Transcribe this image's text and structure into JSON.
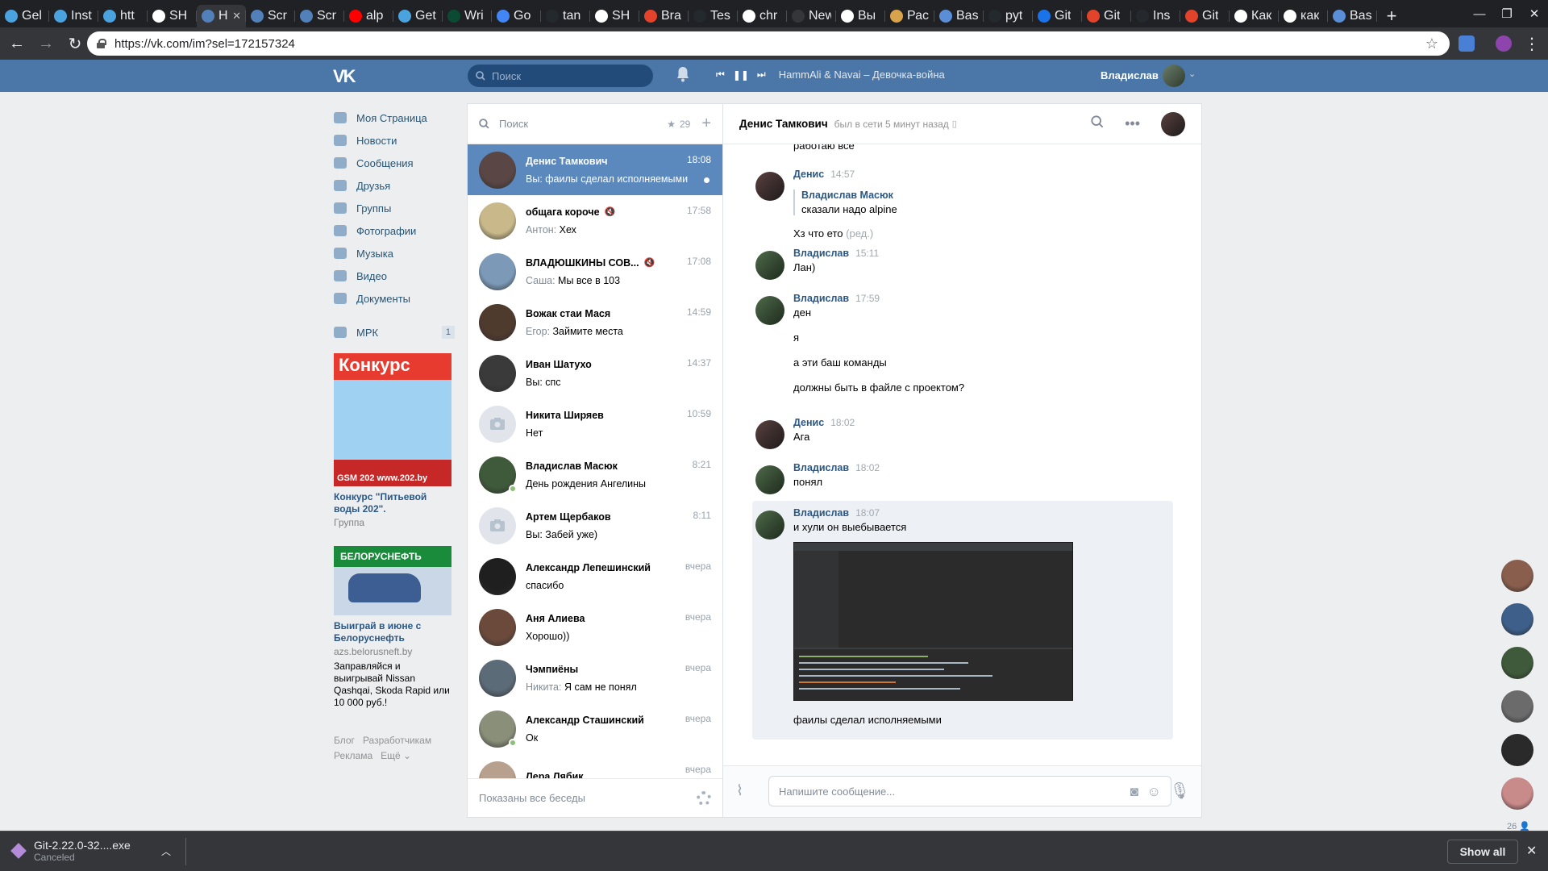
{
  "browser": {
    "tabs": [
      {
        "label": "Gel",
        "color": "#4aa3df"
      },
      {
        "label": "Inst",
        "color": "#4aa3df"
      },
      {
        "label": "htt",
        "color": "#4aa3df"
      },
      {
        "label": "SH",
        "color": "#ffffff"
      },
      {
        "label": "H",
        "color": "#5181b8",
        "active": true
      },
      {
        "label": "Scr",
        "color": "#5181b8"
      },
      {
        "label": "Scr",
        "color": "#5181b8"
      },
      {
        "label": "alp",
        "color": "#ff0000"
      },
      {
        "label": "Get",
        "color": "#4aa3df"
      },
      {
        "label": "Wri",
        "color": "#0c4b33"
      },
      {
        "label": "Go",
        "color": "#4285f4"
      },
      {
        "label": "tan",
        "color": "#24292e"
      },
      {
        "label": "SH",
        "color": "#ffffff"
      },
      {
        "label": "Bra",
        "color": "#e2432a"
      },
      {
        "label": "Tes",
        "color": "#24292e"
      },
      {
        "label": "chr",
        "color": "#ffffff"
      },
      {
        "label": "New Ta",
        "color": "#35363a"
      },
      {
        "label": "Вы",
        "color": "#ffffff"
      },
      {
        "label": "Рас",
        "color": "#d8a34a"
      },
      {
        "label": "Bas",
        "color": "#5a8fd8"
      },
      {
        "label": "pyt",
        "color": "#24292e"
      },
      {
        "label": "Git",
        "color": "#1a73e8"
      },
      {
        "label": "Git",
        "color": "#e2432a"
      },
      {
        "label": "Ins",
        "color": "#24292e"
      },
      {
        "label": "Git",
        "color": "#e2432a"
      },
      {
        "label": "Как",
        "color": "#ffffff"
      },
      {
        "label": "как",
        "color": "#ffffff"
      },
      {
        "label": "Bas",
        "color": "#5a8fd8"
      }
    ],
    "new_tab_glyph": "+",
    "url": "https://vk.com/im?sel=172157324"
  },
  "vk": {
    "logo": "VK",
    "search_placeholder": "Поиск",
    "player": {
      "prev": "⏮",
      "pause": "❚❚",
      "next": "⏭",
      "track": "HammAli & Navai – Девочка-война"
    },
    "user_name": "Владислав",
    "accent": "#4a76a8"
  },
  "left_nav": {
    "items": [
      {
        "label": "Моя Страница",
        "icon": "home-icon"
      },
      {
        "label": "Новости",
        "icon": "news-icon"
      },
      {
        "label": "Сообщения",
        "icon": "messages-icon"
      },
      {
        "label": "Друзья",
        "icon": "friends-icon"
      },
      {
        "label": "Группы",
        "icon": "groups-icon"
      },
      {
        "label": "Фотографии",
        "icon": "photos-icon"
      },
      {
        "label": "Музыка",
        "icon": "music-icon"
      },
      {
        "label": "Видео",
        "icon": "video-icon"
      },
      {
        "label": "Документы",
        "icon": "documents-icon"
      }
    ],
    "group": {
      "label": "МРК",
      "count": "1"
    },
    "ad1": {
      "banner_title": "Конкурс",
      "banner_bottom": "GSM 202  www.202.by",
      "title": "Конкурс \"Питьевой воды 202\".",
      "sub": "Группа"
    },
    "ad2": {
      "banner_title": "БЕЛОРУСНЕФТЬ",
      "title": "Выиграй в июне с Белоруснефть",
      "sub": "azs.belorusneft.by",
      "text": "Заправляйся и выигрывай Nissan Qashqai, Skoda Rapid или 10 000 руб.!"
    },
    "footer": [
      "Блог",
      "Разработчикам",
      "Реклама",
      "Ещё ⌄"
    ]
  },
  "conversations": {
    "search_placeholder": "Поиск",
    "favorites_count": "29",
    "items": [
      {
        "name": "Денис Тамкович",
        "preview_who": "",
        "preview": "Вы: фаилы сделал исполняемыми",
        "time": "18:08",
        "active": true,
        "unread": true,
        "muted": false,
        "online": false,
        "av": "#5a4745"
      },
      {
        "name": "общага короче",
        "preview_who": "Антон:",
        "preview": " Хех",
        "time": "17:58",
        "muted": true,
        "av": "#c9b98a"
      },
      {
        "name": "ВЛАДЮШКИНЫ СОВ...",
        "preview_who": "Саша:",
        "preview": " Мы все в 103",
        "time": "17:08",
        "muted": true,
        "av": "#7c9ab8"
      },
      {
        "name": "Вожак стаи Мася",
        "preview_who": "Егор:",
        "preview": " Займите места",
        "time": "14:59",
        "av": "#4f3a2e"
      },
      {
        "name": "Иван Шатухо",
        "preview_who": "",
        "preview": "Вы: спс",
        "time": "14:37",
        "av": "#3a3a3a"
      },
      {
        "name": "Никита Ширяев",
        "preview_who": "",
        "preview": "Нет",
        "time": "10:59",
        "av": "#e1e5eb",
        "camera": true
      },
      {
        "name": "Владислав Масюк",
        "preview_who": "",
        "preview": "День рождения Ангелины",
        "time": "8:21",
        "online": true,
        "av": "#3f5a3a"
      },
      {
        "name": "Артем Щербаков",
        "preview_who": "",
        "preview": "Вы: Забей уже)",
        "time": "8:11",
        "av": "#e1e5eb",
        "camera": true
      },
      {
        "name": "Александр Лепешинский",
        "preview_who": "",
        "preview": "спасибо",
        "time": "вчера",
        "av": "#1f1f1f"
      },
      {
        "name": "Аня Алиева",
        "preview_who": "",
        "preview": "Хорошо))",
        "time": "вчера",
        "av": "#6b4a3c"
      },
      {
        "name": "Чэмпиёны",
        "preview_who": "Никита:",
        "preview": " Я сам не понял",
        "time": "вчера",
        "av": "#5c6b78"
      },
      {
        "name": "Александр Сташинский",
        "preview_who": "",
        "preview": "Ок",
        "time": "вчера",
        "online": true,
        "av": "#8a8f7a"
      },
      {
        "name": "Лера Лябик",
        "preview_who": "",
        "preview": "",
        "time": "вчера",
        "av": "#b7a18e"
      }
    ],
    "footer": "Показаны все беседы"
  },
  "chat": {
    "name": "Денис Тамкович",
    "status": "был в сети 5 минут назад",
    "top_cut": "работаю все",
    "groups": [
      {
        "author": "Денис",
        "time": "14:57",
        "quote_author": "Владислав Масюк",
        "quote_text": "сказали надо alpine",
        "lines": [
          "Хз что ето"
        ],
        "edited": "(ред.)"
      },
      {
        "author": "Владислав",
        "time": "15:11",
        "lines": [
          "Лан)"
        ]
      },
      {
        "author": "Владислав",
        "time": "17:59",
        "lines": [
          "ден",
          "я",
          "а эти баш команды",
          "должны быть в файле с проектом?"
        ]
      },
      {
        "author": "Денис",
        "time": "18:02",
        "lines": [
          "Ага"
        ]
      },
      {
        "author": "Владислав",
        "time": "18:02",
        "lines": [
          "понял"
        ]
      },
      {
        "author": "Владислав",
        "time": "18:07",
        "lines": [
          "и хули он выебывается",
          "фаилы сделал исполняемыми"
        ]
      }
    ],
    "composer_placeholder": "Напишите сообщение..."
  },
  "minichat": {
    "avatars": [
      "#8a5e4d",
      "#3d5f8a",
      "#3f5a3a",
      "#6b6b6b",
      "#2a2a2a",
      "#c98a8a"
    ],
    "count": "26"
  },
  "downloads": {
    "file": "Git-2.22.0-32....exe",
    "status": "Canceled",
    "show_all": "Show all"
  }
}
